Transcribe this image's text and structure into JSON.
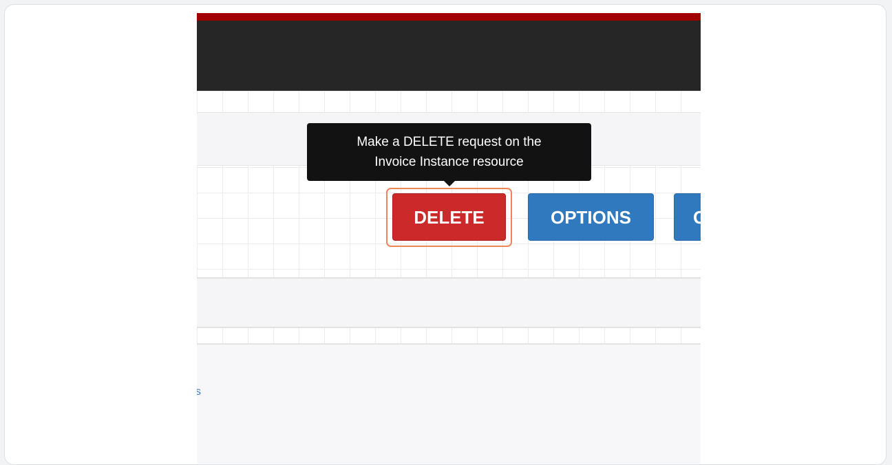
{
  "tooltip": {
    "line1": "Make a DELETE request on the",
    "line2": "Invoice Instance resource"
  },
  "buttons": {
    "delete_label": "DELETE",
    "options_label": "OPTIONS",
    "partial_label": "G"
  },
  "link_fragment": "s",
  "colors": {
    "accent_red": "#a30000",
    "navbar": "#262626",
    "delete_button": "#cc2a2a",
    "options_button": "#3179bf",
    "highlight": "#f0845a",
    "tooltip_bg": "#121212"
  }
}
